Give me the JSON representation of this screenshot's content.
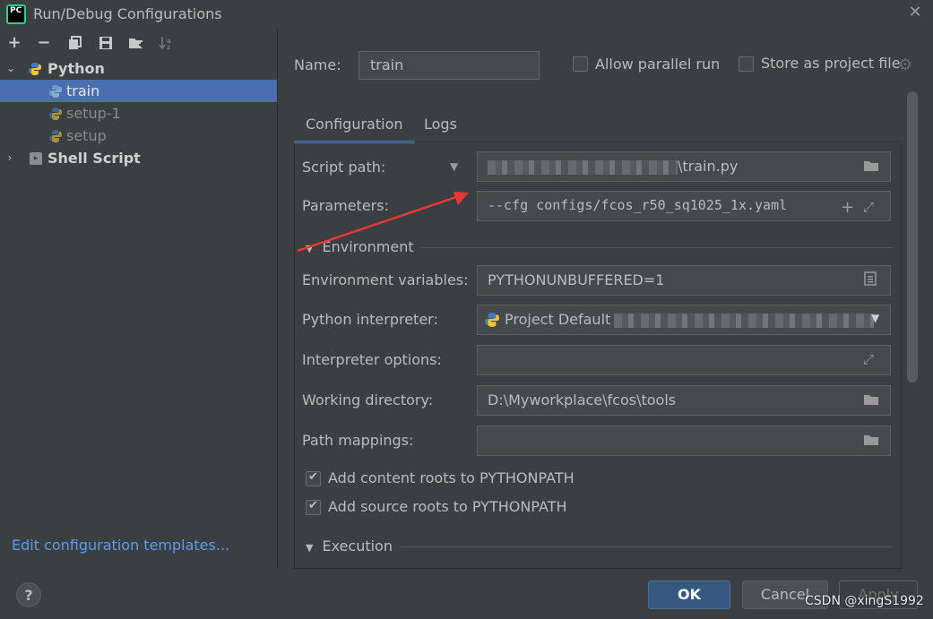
{
  "window": {
    "title": "Run/Debug Configurations",
    "logo_text": "PC",
    "close_glyph": "✕"
  },
  "toolbar": {
    "add": "+",
    "remove": "−",
    "copy": "⧉",
    "save": "💾",
    "folder": "📁",
    "sort": "↓ᵃ"
  },
  "tree": {
    "python_group": "Python",
    "items": [
      "train",
      "setup-1",
      "setup"
    ],
    "shell_group": "Shell Script"
  },
  "left_footer": {
    "edit_templates": "Edit configuration templates..."
  },
  "header": {
    "name_label": "Name:",
    "name_value": "train",
    "allow_parallel": "Allow parallel run",
    "allow_parallel_checked": false,
    "store_as_project": "Store as project file",
    "store_checked": false
  },
  "tabs": [
    "Configuration",
    "Logs"
  ],
  "fields": {
    "script_path_label": "Script path:",
    "script_path_value": "\\train.py",
    "parameters_label": "Parameters:",
    "parameters_value": "--cfg configs/fcos_r50_sq1025_1x.yaml",
    "environment_section": "Environment",
    "env_vars_label": "Environment variables:",
    "env_vars_value": "PYTHONUNBUFFERED=1",
    "interpreter_label": "Python interpreter:",
    "interpreter_value": "Project Default",
    "interpreter_options_label": "Interpreter options:",
    "interpreter_options_value": "",
    "working_dir_label": "Working directory:",
    "working_dir_value": "D:\\Myworkplace\\fcos\\tools",
    "path_mappings_label": "Path mappings:",
    "path_mappings_value": "",
    "content_roots": "Add content roots to PYTHONPATH",
    "content_roots_checked": true,
    "source_roots": "Add source roots to PYTHONPATH",
    "source_roots_checked": true,
    "execution_section": "Execution"
  },
  "buttons": {
    "help": "?",
    "ok": "OK",
    "cancel": "Cancel",
    "apply": "Apply"
  },
  "watermark": "CSDN @xingS1992",
  "colors": {
    "accent": "#4a88c7",
    "selection": "#4b6eaf",
    "link": "#589df6",
    "arrow": "#e53935"
  }
}
